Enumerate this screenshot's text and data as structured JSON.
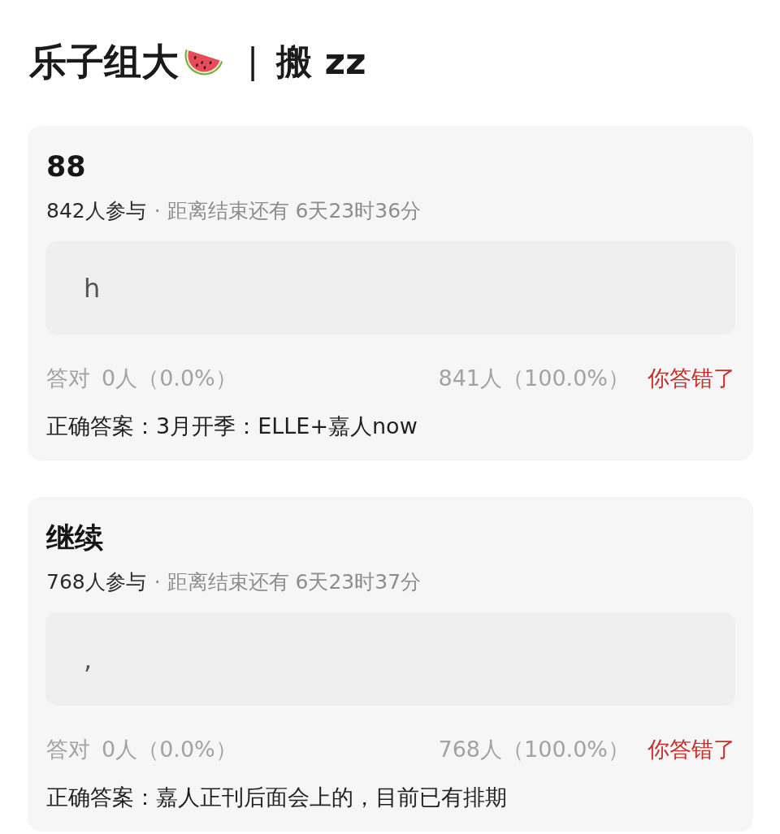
{
  "header": {
    "title": "乐子组大",
    "separator": "|",
    "subtitle": "搬 zz"
  },
  "polls": [
    {
      "title": "88",
      "participants": "842人参与",
      "deadline": "· 距离结束还有 6天23时36分",
      "my_answer": "h",
      "correct_label": "答对",
      "correct_count": "0人（0.0%）",
      "wrong_count": "841人（100.0%）",
      "result": {
        "kind": "wrong",
        "text": "你答错了"
      },
      "correct_answer": "正确答案：3月开季：ELLE+嘉人now"
    },
    {
      "title": "继续",
      "participants": "768人参与",
      "deadline": "· 距离结束还有 6天23时37分",
      "my_answer": ",",
      "correct_label": "答对",
      "correct_count": "0人（0.0%）",
      "wrong_count": "768人（100.0%）",
      "result": {
        "kind": "wrong",
        "text": "你答错了"
      },
      "correct_answer": "正确答案：嘉人正刊后面会上的，目前已有排期"
    }
  ]
}
